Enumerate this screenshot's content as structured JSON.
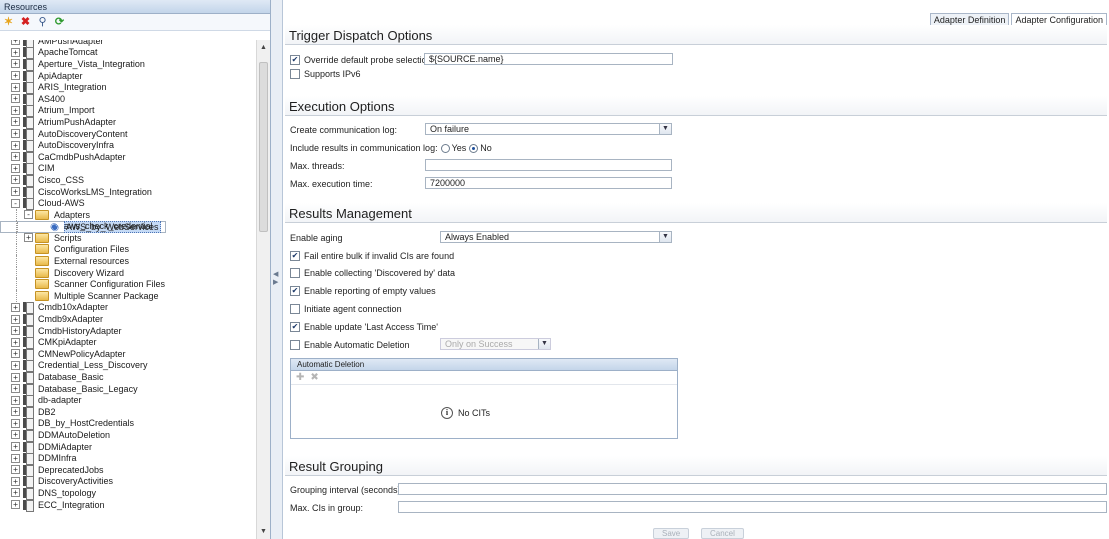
{
  "left_panel": {
    "title": "Resources",
    "tree": [
      {
        "label": "AMPushAdapter",
        "level": 0,
        "type": "book",
        "exp": "+"
      },
      {
        "label": "ApacheTomcat",
        "level": 0,
        "type": "book",
        "exp": "+"
      },
      {
        "label": "Aperture_Vista_Integration",
        "level": 0,
        "type": "book",
        "exp": "+"
      },
      {
        "label": "ApiAdapter",
        "level": 0,
        "type": "book",
        "exp": "+"
      },
      {
        "label": "ARIS_Integration",
        "level": 0,
        "type": "book",
        "exp": "+"
      },
      {
        "label": "AS400",
        "level": 0,
        "type": "book",
        "exp": "+"
      },
      {
        "label": "Atrium_Import",
        "level": 0,
        "type": "book",
        "exp": "+"
      },
      {
        "label": "AtriumPushAdapter",
        "level": 0,
        "type": "book",
        "exp": "+"
      },
      {
        "label": "AutoDiscoveryContent",
        "level": 0,
        "type": "book",
        "exp": "+"
      },
      {
        "label": "AutoDiscoveryInfra",
        "level": 0,
        "type": "book",
        "exp": "+"
      },
      {
        "label": "CaCmdbPushAdapter",
        "level": 0,
        "type": "book",
        "exp": "+"
      },
      {
        "label": "CIM",
        "level": 0,
        "type": "book",
        "exp": "+"
      },
      {
        "label": "Cisco_CSS",
        "level": 0,
        "type": "book",
        "exp": "+"
      },
      {
        "label": "CiscoWorksLMS_Integration",
        "level": 0,
        "type": "book",
        "exp": "+"
      },
      {
        "label": "Cloud-AWS",
        "level": 0,
        "type": "book",
        "exp": "-"
      },
      {
        "label": "Adapters",
        "level": 1,
        "type": "folder",
        "exp": "-"
      },
      {
        "label": "AWS_by_WebServices",
        "level": 2,
        "type": "adapter",
        "exp": "",
        "selected": true
      },
      {
        "label": "aws_check_credential",
        "level": 2,
        "type": "adapter",
        "exp": ""
      },
      {
        "label": "Scripts",
        "level": 1,
        "type": "folder",
        "exp": "+"
      },
      {
        "label": "Configuration Files",
        "level": 1,
        "type": "folder",
        "exp": ""
      },
      {
        "label": "External resources",
        "level": 1,
        "type": "folder",
        "exp": ""
      },
      {
        "label": "Discovery Wizard",
        "level": 1,
        "type": "folder",
        "exp": ""
      },
      {
        "label": "Scanner Configuration Files",
        "level": 1,
        "type": "folder",
        "exp": ""
      },
      {
        "label": "Multiple Scanner Package",
        "level": 1,
        "type": "folder",
        "exp": ""
      },
      {
        "label": "Cmdb10xAdapter",
        "level": 0,
        "type": "book",
        "exp": "+"
      },
      {
        "label": "Cmdb9xAdapter",
        "level": 0,
        "type": "book",
        "exp": "+"
      },
      {
        "label": "CmdbHistoryAdapter",
        "level": 0,
        "type": "book",
        "exp": "+"
      },
      {
        "label": "CMKpiAdapter",
        "level": 0,
        "type": "book",
        "exp": "+"
      },
      {
        "label": "CMNewPolicyAdapter",
        "level": 0,
        "type": "book",
        "exp": "+"
      },
      {
        "label": "Credential_Less_Discovery",
        "level": 0,
        "type": "book",
        "exp": "+"
      },
      {
        "label": "Database_Basic",
        "level": 0,
        "type": "book",
        "exp": "+"
      },
      {
        "label": "Database_Basic_Legacy",
        "level": 0,
        "type": "book",
        "exp": "+"
      },
      {
        "label": "db-adapter",
        "level": 0,
        "type": "book",
        "exp": "+"
      },
      {
        "label": "DB2",
        "level": 0,
        "type": "book",
        "exp": "+"
      },
      {
        "label": "DB_by_HostCredentials",
        "level": 0,
        "type": "book",
        "exp": "+"
      },
      {
        "label": "DDMAutoDeletion",
        "level": 0,
        "type": "book",
        "exp": "+"
      },
      {
        "label": "DDMiAdapter",
        "level": 0,
        "type": "book",
        "exp": "+"
      },
      {
        "label": "DDMInfra",
        "level": 0,
        "type": "book",
        "exp": "+"
      },
      {
        "label": "DeprecatedJobs",
        "level": 0,
        "type": "book",
        "exp": "+"
      },
      {
        "label": "DiscoveryActivities",
        "level": 0,
        "type": "book",
        "exp": "+"
      },
      {
        "label": "DNS_topology",
        "level": 0,
        "type": "book",
        "exp": "+"
      },
      {
        "label": "ECC_Integration",
        "level": 0,
        "type": "book",
        "exp": "+"
      }
    ]
  },
  "tabs": [
    {
      "label": "Adapter Definition",
      "active": false
    },
    {
      "label": "Adapter Configuration",
      "active": true
    }
  ],
  "trigger": {
    "title": "Trigger Dispatch Options",
    "override_label": "Override default probe selection",
    "override_checked": true,
    "override_value": "${SOURCE.name}",
    "ipv6_label": "Supports IPv6",
    "ipv6_checked": false
  },
  "execution": {
    "title": "Execution Options",
    "comm_log_label": "Create communication log:",
    "comm_log_value": "On failure",
    "include_label": "Include results in communication log:",
    "yes_label": "Yes",
    "no_label": "No",
    "max_threads_label": "Max. threads:",
    "max_threads_value": "",
    "max_exec_label": "Max. execution time:",
    "max_exec_value": "7200000"
  },
  "results": {
    "title": "Results Management",
    "aging_label": "Enable aging",
    "aging_value": "Always Enabled",
    "fail_bulk_label": "Fail entire bulk if invalid CIs are found",
    "fail_bulk_checked": true,
    "discovered_by_label": "Enable collecting 'Discovered by' data",
    "discovered_by_checked": false,
    "empty_values_label": "Enable reporting of empty values",
    "empty_values_checked": true,
    "agent_label": "Initiate agent connection",
    "agent_checked": false,
    "last_access_label": "Enable update 'Last Access Time'",
    "last_access_checked": true,
    "auto_del_label": "Enable Automatic Deletion",
    "auto_del_checked": false,
    "auto_del_select": "Only on Success",
    "auto_del_panel_title": "Automatic Deletion",
    "no_cits": "No CITs"
  },
  "grouping": {
    "title": "Result Grouping",
    "interval_label": "Grouping interval (seconds):",
    "interval_value": "",
    "max_cis_label": "Max. CIs in group:",
    "max_cis_value": ""
  },
  "buttons": {
    "save": "Save",
    "cancel": "Cancel"
  }
}
